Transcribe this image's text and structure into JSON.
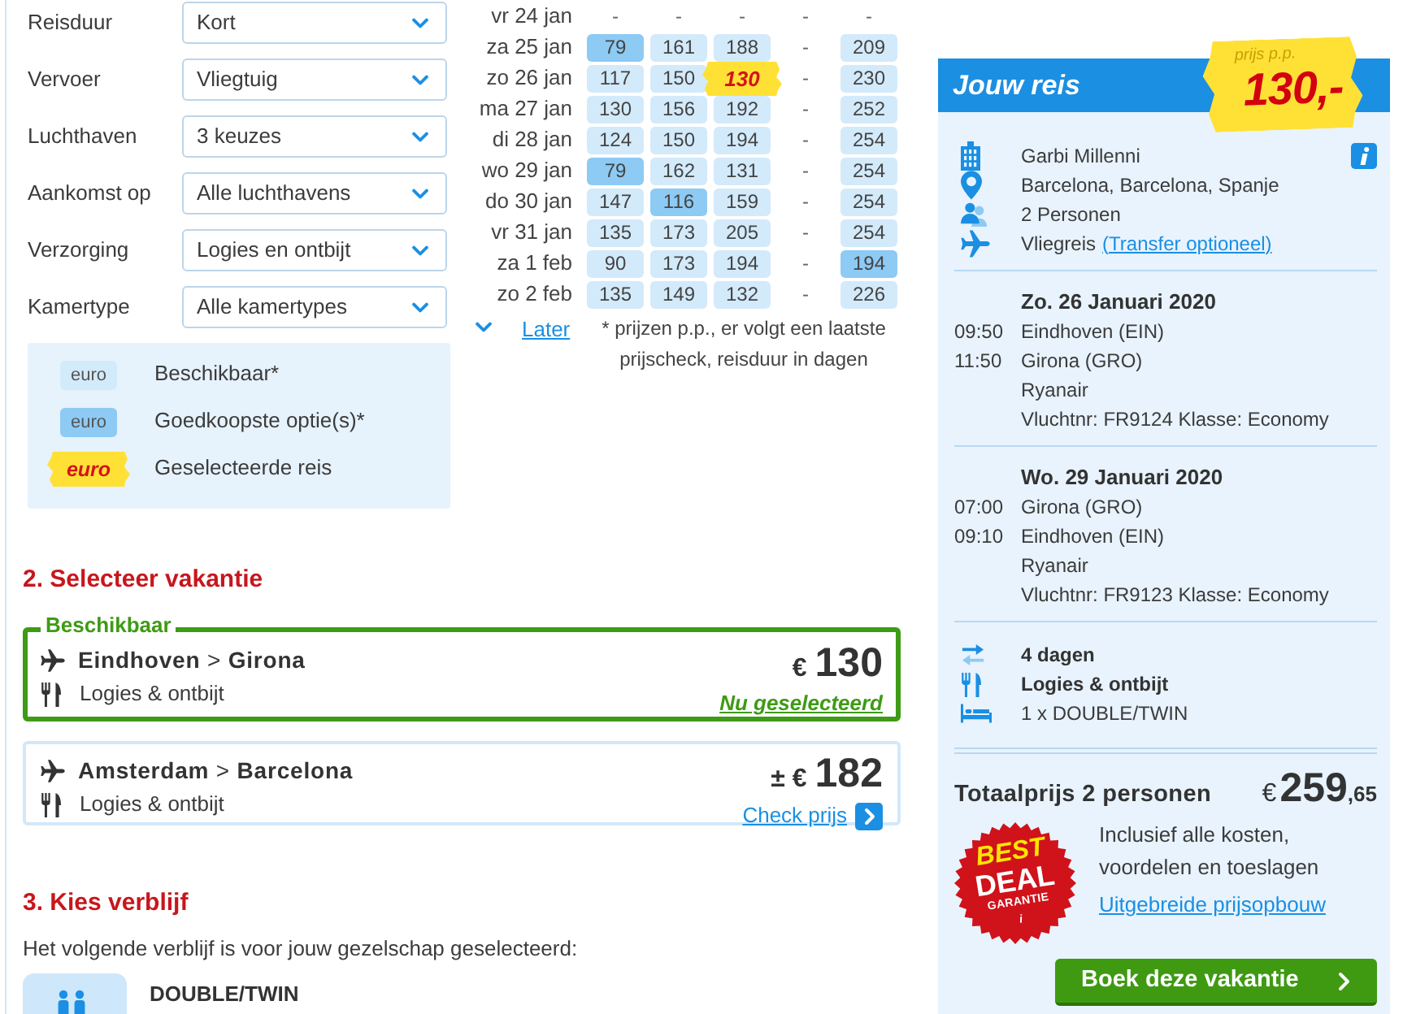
{
  "search_filters": [
    {
      "label": "Reisduur",
      "value": "Kort"
    },
    {
      "label": "Vervoer",
      "value": "Vliegtuig"
    },
    {
      "label": "Luchthaven",
      "value": "3 keuzes"
    },
    {
      "label": "Aankomst op",
      "value": "Alle luchthavens"
    },
    {
      "label": "Verzorging",
      "value": "Logies en ontbijt"
    },
    {
      "label": "Kamertype",
      "value": "Alle kamertypes"
    }
  ],
  "legend": [
    {
      "kind": "available",
      "sample": "euro",
      "label": "Beschikbaar*"
    },
    {
      "kind": "cheapest",
      "sample": "euro",
      "label": "Goedkoopste optie(s)*"
    },
    {
      "kind": "selected",
      "sample": "euro",
      "label": "Geselecteerde reis"
    }
  ],
  "price_calendar": {
    "rows": [
      {
        "date": "vr 24 jan",
        "cells": [
          {
            "kind": "none",
            "text": "-"
          },
          {
            "kind": "none",
            "text": "-"
          },
          {
            "kind": "none",
            "text": "-"
          },
          {
            "kind": "none",
            "text": "-"
          },
          {
            "kind": "none",
            "text": "-"
          }
        ]
      },
      {
        "date": "za 25 jan",
        "cells": [
          {
            "kind": "price",
            "text": "79",
            "cheapest": true,
            "selected": false
          },
          {
            "kind": "price",
            "text": "161",
            "cheapest": false,
            "selected": false
          },
          {
            "kind": "price",
            "text": "188",
            "cheapest": false,
            "selected": false
          },
          {
            "kind": "none",
            "text": "-"
          },
          {
            "kind": "price",
            "text": "209",
            "cheapest": false,
            "selected": false
          }
        ]
      },
      {
        "date": "zo 26 jan",
        "cells": [
          {
            "kind": "price",
            "text": "117",
            "cheapest": false,
            "selected": false
          },
          {
            "kind": "price",
            "text": "150",
            "cheapest": false,
            "selected": false
          },
          {
            "kind": "price",
            "text": "130",
            "cheapest": false,
            "selected": true
          },
          {
            "kind": "none",
            "text": "-"
          },
          {
            "kind": "price",
            "text": "230",
            "cheapest": false,
            "selected": false
          }
        ]
      },
      {
        "date": "ma 27 jan",
        "cells": [
          {
            "kind": "price",
            "text": "130",
            "cheapest": false,
            "selected": false
          },
          {
            "kind": "price",
            "text": "156",
            "cheapest": false,
            "selected": false
          },
          {
            "kind": "price",
            "text": "192",
            "cheapest": false,
            "selected": false
          },
          {
            "kind": "none",
            "text": "-"
          },
          {
            "kind": "price",
            "text": "252",
            "cheapest": false,
            "selected": false
          }
        ]
      },
      {
        "date": "di 28 jan",
        "cells": [
          {
            "kind": "price",
            "text": "124",
            "cheapest": false,
            "selected": false
          },
          {
            "kind": "price",
            "text": "150",
            "cheapest": false,
            "selected": false
          },
          {
            "kind": "price",
            "text": "194",
            "cheapest": false,
            "selected": false
          },
          {
            "kind": "none",
            "text": "-"
          },
          {
            "kind": "price",
            "text": "254",
            "cheapest": false,
            "selected": false
          }
        ]
      },
      {
        "date": "wo 29 jan",
        "cells": [
          {
            "kind": "price",
            "text": "79",
            "cheapest": true,
            "selected": false
          },
          {
            "kind": "price",
            "text": "162",
            "cheapest": false,
            "selected": false
          },
          {
            "kind": "price",
            "text": "131",
            "cheapest": false,
            "selected": false
          },
          {
            "kind": "none",
            "text": "-"
          },
          {
            "kind": "price",
            "text": "254",
            "cheapest": false,
            "selected": false
          }
        ]
      },
      {
        "date": "do 30 jan",
        "cells": [
          {
            "kind": "price",
            "text": "147",
            "cheapest": false,
            "selected": false
          },
          {
            "kind": "price",
            "text": "116",
            "cheapest": true,
            "selected": false
          },
          {
            "kind": "price",
            "text": "159",
            "cheapest": false,
            "selected": false
          },
          {
            "kind": "none",
            "text": "-"
          },
          {
            "kind": "price",
            "text": "254",
            "cheapest": false,
            "selected": false
          }
        ]
      },
      {
        "date": "vr 31 jan",
        "cells": [
          {
            "kind": "price",
            "text": "135",
            "cheapest": false,
            "selected": false
          },
          {
            "kind": "price",
            "text": "173",
            "cheapest": false,
            "selected": false
          },
          {
            "kind": "price",
            "text": "205",
            "cheapest": false,
            "selected": false
          },
          {
            "kind": "none",
            "text": "-"
          },
          {
            "kind": "price",
            "text": "254",
            "cheapest": false,
            "selected": false
          }
        ]
      },
      {
        "date": "za 1 feb",
        "cells": [
          {
            "kind": "price",
            "text": "90",
            "cheapest": false,
            "selected": false
          },
          {
            "kind": "price",
            "text": "173",
            "cheapest": false,
            "selected": false
          },
          {
            "kind": "price",
            "text": "194",
            "cheapest": false,
            "selected": false
          },
          {
            "kind": "none",
            "text": "-"
          },
          {
            "kind": "price",
            "text": "194",
            "cheapest": true,
            "selected": false
          }
        ]
      },
      {
        "date": "zo 2 feb",
        "cells": [
          {
            "kind": "price",
            "text": "135",
            "cheapest": false,
            "selected": false
          },
          {
            "kind": "price",
            "text": "149",
            "cheapest": false,
            "selected": false
          },
          {
            "kind": "price",
            "text": "132",
            "cheapest": false,
            "selected": false
          },
          {
            "kind": "none",
            "text": "-"
          },
          {
            "kind": "price",
            "text": "226",
            "cheapest": false,
            "selected": false
          }
        ]
      }
    ],
    "later_link": "Later",
    "note": "* prijzen p.p., er volgt een laatste prijscheck, reisduur in dagen"
  },
  "select_holiday": {
    "heading": "2. Selecteer vakantie",
    "options": [
      {
        "selected": true,
        "availability": "Beschikbaar",
        "route": "**Eindhoven** > **Girona**",
        "board": "Logies & ontbijt",
        "currency": "€",
        "price": "130",
        "action": "Nu geselecteerd"
      },
      {
        "selected": false,
        "route": "**Amsterdam** > **Barcelona**",
        "board": "Logies & ontbijt",
        "currency": "± €",
        "price": "182",
        "action": "Check prijs"
      }
    ]
  },
  "choose_stay": {
    "heading": "3. Kies verblijf",
    "intro": "Het volgende verblijf is voor jouw gezelschap geselecteerd:",
    "room": "DOUBLE/TWIN"
  },
  "trip_summary": {
    "title": "Jouw reis",
    "price_tag": {
      "label": "prijs p.p.",
      "price": "130,-"
    },
    "details": [
      {
        "kind": "hotel",
        "text": "Garbi Millenni"
      },
      {
        "kind": "location",
        "text": "Barcelona, Barcelona, Spanje"
      },
      {
        "kind": "persons",
        "text": "2 Personen"
      },
      {
        "kind": "flight",
        "text": "Vliegreis",
        "link": "(Transfer optioneel)"
      }
    ],
    "flights": [
      {
        "date": "Zo. 26 Januari 2020",
        "legs": [
          {
            "time": "09:50",
            "airport": "Eindhoven (EIN)"
          },
          {
            "time": "11:50",
            "airport": "Girona (GRO)"
          }
        ],
        "airline": "Ryanair",
        "flight_info": "Vluchtnr: FR9124 Klasse: Economy"
      },
      {
        "date": "Wo. 29 Januari 2020",
        "legs": [
          {
            "time": "07:00",
            "airport": "Girona (GRO)"
          },
          {
            "time": "09:10",
            "airport": "Eindhoven (EIN)"
          }
        ],
        "airline": "Ryanair",
        "flight_info": "Vluchtnr: FR9123 Klasse: Economy"
      }
    ],
    "package": [
      {
        "kind": "duration",
        "text": "4 dagen"
      },
      {
        "kind": "board",
        "text": "Logies & ontbijt"
      },
      {
        "kind": "room",
        "text": "1 x DOUBLE/TWIN"
      }
    ],
    "total": {
      "label": "Totaalprijs 2 personen",
      "currency": "€",
      "amount": "259",
      "cents": ",65"
    },
    "guarantee_badge": [
      "BEST",
      "DEAL",
      "GARANTIE",
      "i"
    ],
    "included": "Inclusief alle kosten, voordelen en toeslagen",
    "breakdown_link": "Uitgebreide prijsopbouw",
    "book_button": "Boek deze vakantie"
  }
}
